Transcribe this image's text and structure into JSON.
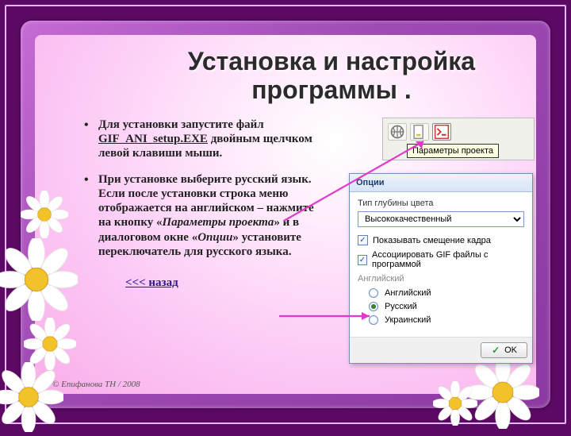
{
  "title": "Установка и настройка программы .",
  "bullets": {
    "b1_a": "Для установки запустите файл ",
    "b1_file": "GIF_ANI_setup.EXE",
    "b1_b": " двойным щелчком левой клавиши мыши.",
    "b2_a": "При установке выберите русский язык.",
    "b2_b": " Если после установки строка меню отображается на английском – нажмите на кнопку «",
    "b2_i1": "Параметры проекта",
    "b2_c": "» и в диалоговом окне «",
    "b2_i2": "Опции",
    "b2_d": "» установите переключатель для русского языка."
  },
  "back_link": "<<< назад",
  "copyright": "© Епифанова ТН / 2008",
  "toolbar": {
    "tooltip": "Параметры проекта"
  },
  "dialog": {
    "title": "Опции",
    "depth_label": "Тип глубины цвета",
    "depth_value": "Высококачественный",
    "chk1": "Показывать смещение кадра",
    "chk2": "Ассоциировать GIF файлы с программой",
    "lang_head": "Английский",
    "lang_en": "Английский",
    "lang_ru": "Русский",
    "lang_uk": "Украинский",
    "ok": "OK"
  }
}
